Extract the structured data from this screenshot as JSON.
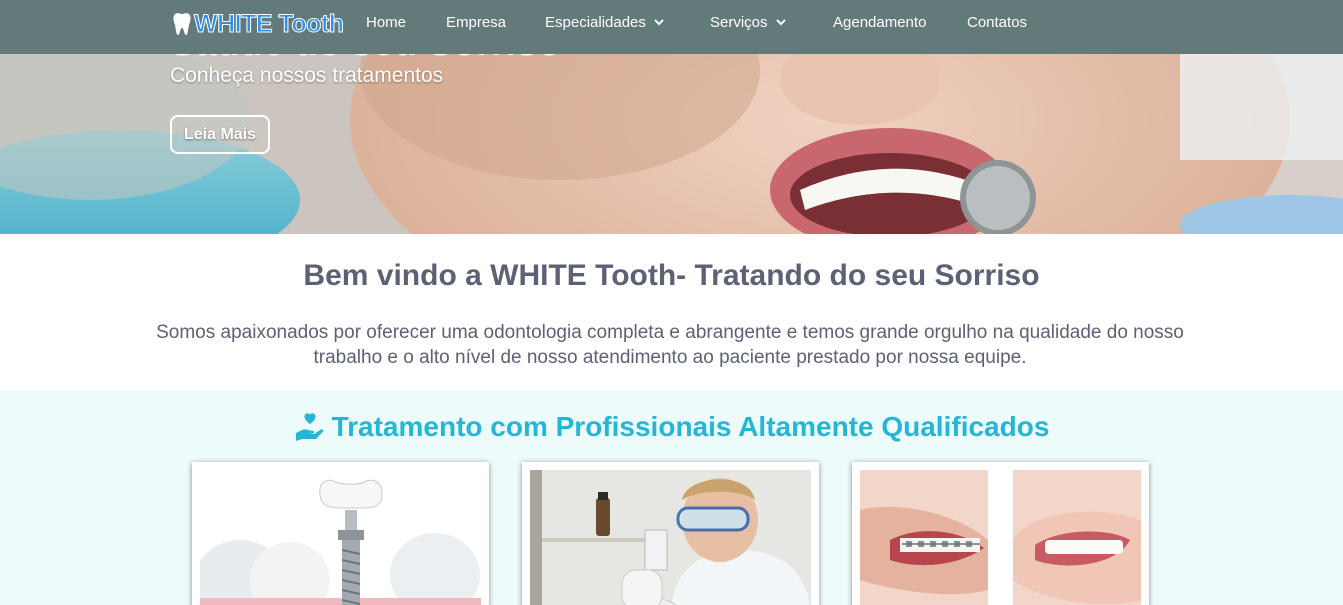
{
  "brand": {
    "name": "WHITE Tooth",
    "logo_icon": "tooth-icon",
    "color": "#2f8fe8"
  },
  "nav": {
    "items": [
      {
        "label": "Home"
      },
      {
        "label": "Empresa"
      },
      {
        "label": "Especialidades",
        "has_dropdown": true
      },
      {
        "label": "Serviços",
        "has_dropdown": true
      },
      {
        "label": "Agendamento"
      },
      {
        "label": "Contatos"
      }
    ],
    "background": "#637a7a"
  },
  "hero": {
    "title_partial": "Saúde do seu Sorriso",
    "subtitle": "Conheça nossos tratamentos",
    "button_label": "Leia Mais"
  },
  "welcome": {
    "title": "Bem vindo a WHITE Tooth- Tratando do seu Sorriso",
    "text": "Somos apaixonados por oferecer uma odontologia completa e abrangente e temos grande orgulho na qualidade do nosso trabalho e o alto nível de nosso atendimento ao paciente prestado por nossa equipe."
  },
  "treatment": {
    "icon": "hand-heart-icon",
    "title": "Tratamento com Profissionais Altamente Qualificados",
    "accent": "#24b6d6",
    "cards": [
      {
        "image": "dental-implant-image"
      },
      {
        "image": "lab-microscope-image"
      },
      {
        "image": "braces-smile-image"
      }
    ]
  }
}
